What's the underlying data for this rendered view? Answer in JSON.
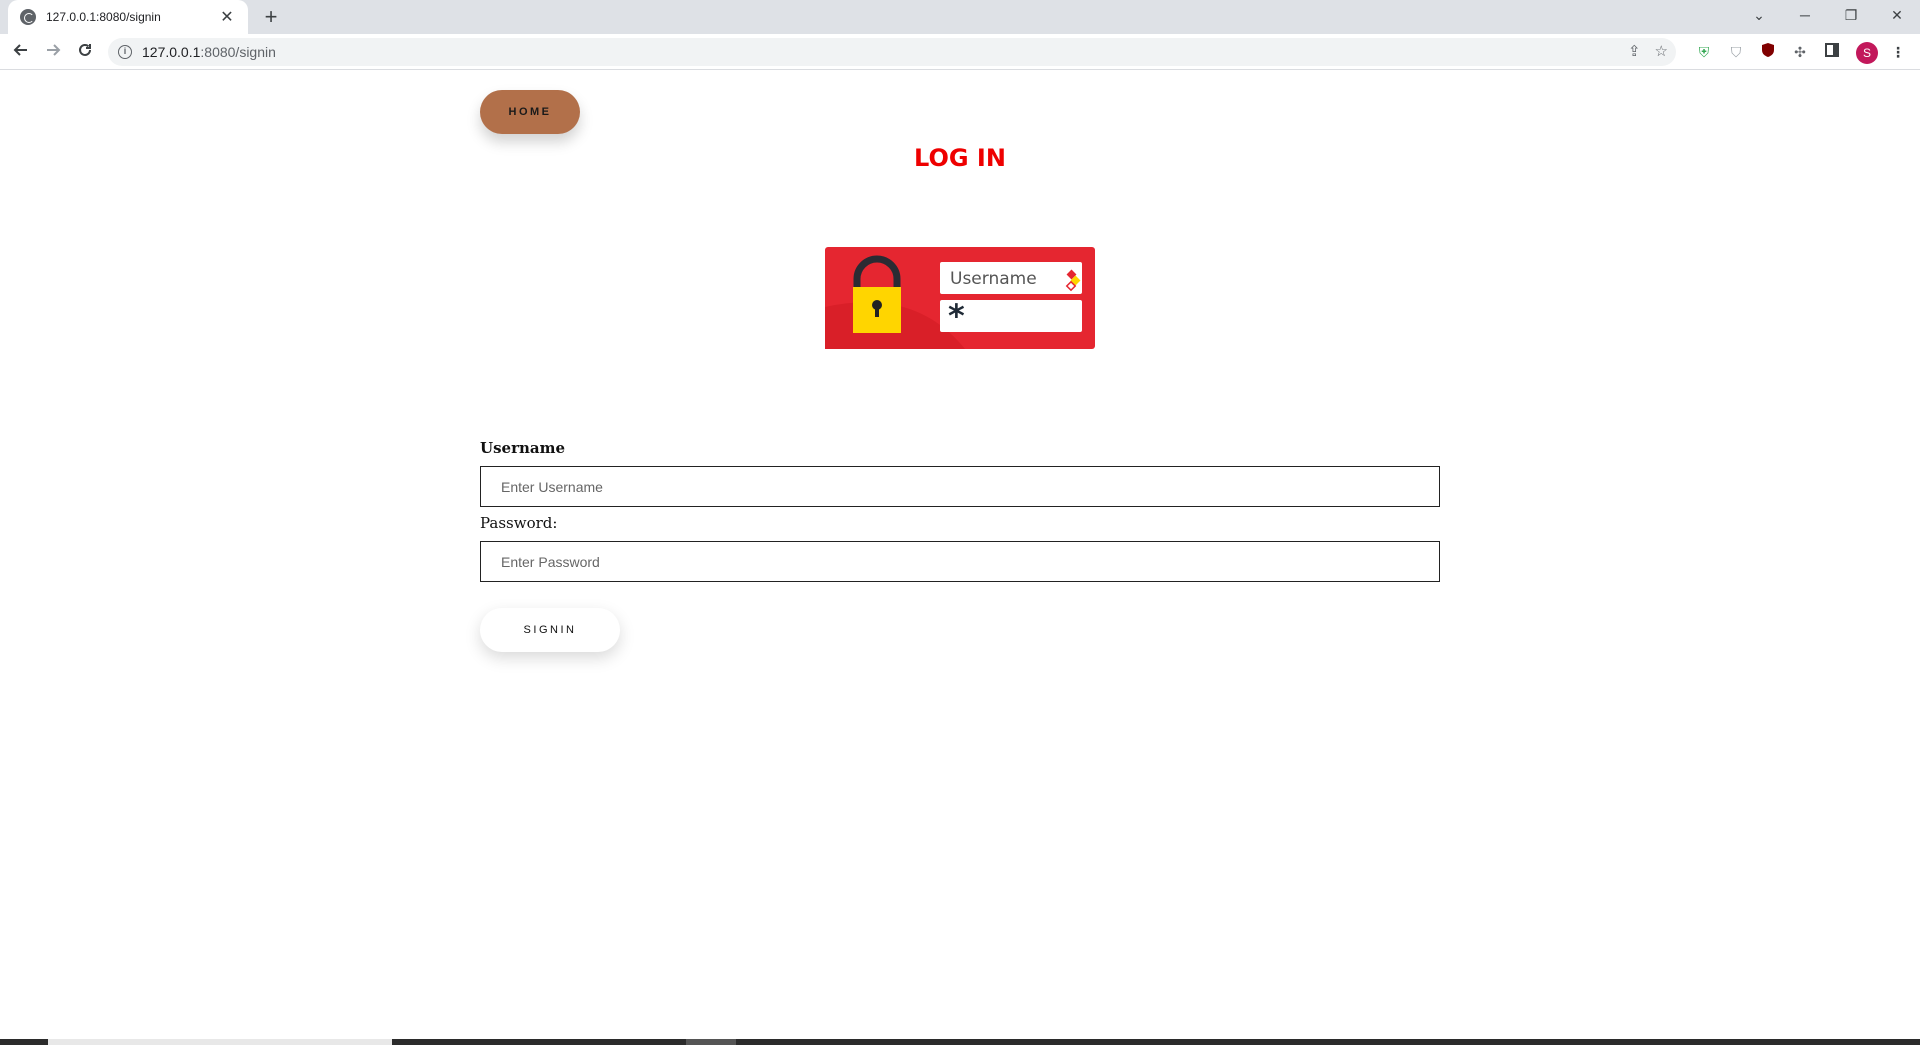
{
  "browser": {
    "tab_title": "127.0.0.1:8080/signin",
    "tab_close": "✕",
    "new_tab": "+",
    "url_host": "127.0.0.1",
    "url_path": ":8080/signin",
    "profile_initial": "S",
    "controls": {
      "dropdown": "⌄",
      "minimize": "─",
      "restore": "❐",
      "close": "✕"
    }
  },
  "page": {
    "home_label": "HOME",
    "title": "LOG IN",
    "image_username_text": "Username",
    "form": {
      "username_label": "Username",
      "username_placeholder": "Enter Username",
      "password_label": "Password:",
      "password_placeholder": "Enter Password",
      "submit_label": "SIGNIN"
    }
  },
  "colors": {
    "title": "#ee0000",
    "home_button": "#b2704a",
    "banner_red": "#e52630",
    "lock_yellow": "#ffd500"
  }
}
